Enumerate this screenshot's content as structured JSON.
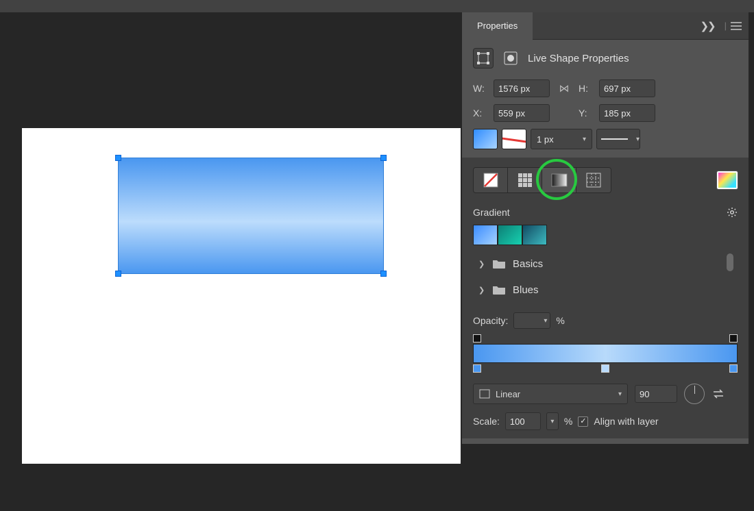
{
  "panel": {
    "title": "Properties",
    "section_title": "Live Shape Properties"
  },
  "dims": {
    "w_label": "W:",
    "h_label": "H:",
    "x_label": "X:",
    "y_label": "Y:",
    "w": "1576 px",
    "h": "697 px",
    "x": "559 px",
    "y": "185 px"
  },
  "stroke": {
    "width_value": "1 px"
  },
  "gradient": {
    "section_label": "Gradient",
    "folders": [
      "Basics",
      "Blues"
    ],
    "opacity_label": "Opacity:",
    "opacity_value": "",
    "opacity_unit": "%",
    "type_label": "Linear",
    "angle": "90",
    "scale_label": "Scale:",
    "scale_value": "100",
    "scale_unit": "%",
    "align_label": "Align with layer",
    "align_checked": true
  }
}
